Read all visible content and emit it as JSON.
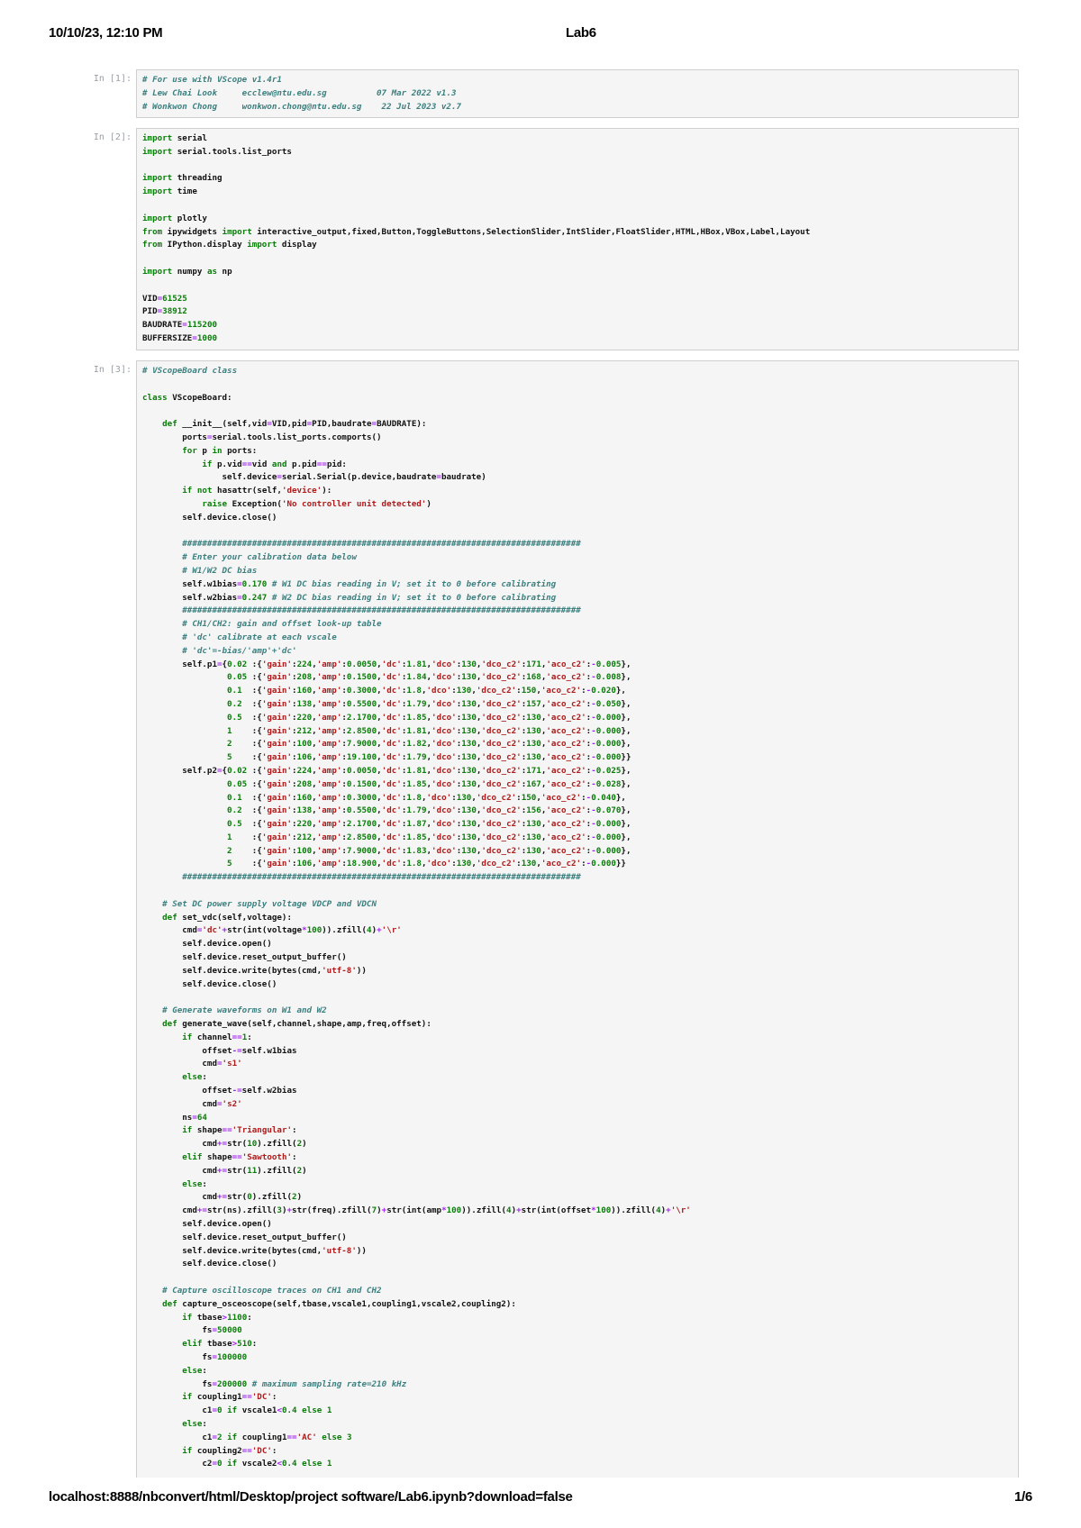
{
  "header": {
    "datetime": "10/10/23, 12:10 PM",
    "title": "Lab6"
  },
  "footer": {
    "url": "localhost:8888/nbconvert/html/Desktop/project software/Lab6.ipynb?download=false",
    "page": "1/6"
  },
  "cells": [
    {
      "prompt": "In [1]:",
      "lines": [
        "# For use with VScope v1.4r1",
        "# Lew Chai Look     ecclew@ntu.edu.sg          07 Mar 2022 v1.3",
        "# Wonkwon Chong     wonkwon.chong@ntu.edu.sg    22 Jul 2023 v2.7"
      ]
    },
    {
      "prompt": "In [2]:",
      "lines": [
        "import serial",
        "import serial.tools.list_ports",
        "",
        "import threading",
        "import time",
        "",
        "import plotly",
        "from ipywidgets import interactive_output,fixed,Button,ToggleButtons,SelectionSlider,IntSlider,FloatSlider,HTML,HBox,VBox,Label,Layout",
        "from IPython.display import display",
        "",
        "import numpy as np",
        "",
        "VID=61525",
        "PID=38912",
        "BAUDRATE=115200",
        "BUFFERSIZE=1000"
      ]
    },
    {
      "prompt": "In [3]:",
      "lines": [
        "# VScopeBoard class",
        "",
        "class VScopeBoard:",
        "",
        "    def __init__(self,vid=VID,pid=PID,baudrate=BAUDRATE):",
        "        ports=serial.tools.list_ports.comports()",
        "        for p in ports:",
        "            if p.vid==vid and p.pid==pid:",
        "                self.device=serial.Serial(p.device,baudrate=baudrate)",
        "        if not hasattr(self,'device'):",
        "            raise Exception('No controller unit detected')",
        "        self.device.close()",
        "",
        "        ################################################################################",
        "        # Enter your calibration data below",
        "        # W1/W2 DC bias",
        "        self.w1bias=0.170 # W1 DC bias reading in V; set it to 0 before calibrating",
        "        self.w2bias=0.247 # W2 DC bias reading in V; set it to 0 before calibrating",
        "        ################################################################################",
        "        # CH1/CH2: gain and offset look-up table",
        "        # 'dc' calibrate at each vscale",
        "        # 'dc'=-bias/'amp'+'dc'",
        "        self.p1={0.02 :{'gain':224,'amp':0.0050,'dc':1.81,'dco':130,'dco_c2':171,'aco_c2':-0.005},",
        "                 0.05 :{'gain':208,'amp':0.1500,'dc':1.84,'dco':130,'dco_c2':168,'aco_c2':-0.008},",
        "                 0.1  :{'gain':160,'amp':0.3000,'dc':1.8,'dco':130,'dco_c2':150,'aco_c2':-0.020},",
        "                 0.2  :{'gain':138,'amp':0.5500,'dc':1.79,'dco':130,'dco_c2':157,'aco_c2':-0.050},",
        "                 0.5  :{'gain':220,'amp':2.1700,'dc':1.85,'dco':130,'dco_c2':130,'aco_c2':-0.000},",
        "                 1    :{'gain':212,'amp':2.8500,'dc':1.81,'dco':130,'dco_c2':130,'aco_c2':-0.000},",
        "                 2    :{'gain':100,'amp':7.9000,'dc':1.82,'dco':130,'dco_c2':130,'aco_c2':-0.000},",
        "                 5    :{'gain':106,'amp':19.100,'dc':1.79,'dco':130,'dco_c2':130,'aco_c2':-0.000}}",
        "        self.p2={0.02 :{'gain':224,'amp':0.0050,'dc':1.81,'dco':130,'dco_c2':171,'aco_c2':-0.025},",
        "                 0.05 :{'gain':208,'amp':0.1500,'dc':1.85,'dco':130,'dco_c2':167,'aco_c2':-0.028},",
        "                 0.1  :{'gain':160,'amp':0.3000,'dc':1.8,'dco':130,'dco_c2':150,'aco_c2':-0.040},",
        "                 0.2  :{'gain':138,'amp':0.5500,'dc':1.79,'dco':130,'dco_c2':156,'aco_c2':-0.070},",
        "                 0.5  :{'gain':220,'amp':2.1700,'dc':1.87,'dco':130,'dco_c2':130,'aco_c2':-0.000},",
        "                 1    :{'gain':212,'amp':2.8500,'dc':1.85,'dco':130,'dco_c2':130,'aco_c2':-0.000},",
        "                 2    :{'gain':100,'amp':7.9000,'dc':1.83,'dco':130,'dco_c2':130,'aco_c2':-0.000},",
        "                 5    :{'gain':106,'amp':18.900,'dc':1.8,'dco':130,'dco_c2':130,'aco_c2':-0.000}}",
        "        ################################################################################",
        "",
        "    # Set DC power supply voltage VDCP and VDCN",
        "    def set_vdc(self,voltage):",
        "        cmd='dc'+str(int(voltage*100)).zfill(4)+'\\r'",
        "        self.device.open()",
        "        self.device.reset_output_buffer()",
        "        self.device.write(bytes(cmd,'utf-8'))",
        "        self.device.close()",
        "",
        "    # Generate waveforms on W1 and W2",
        "    def generate_wave(self,channel,shape,amp,freq,offset):",
        "        if channel==1:",
        "            offset-=self.w1bias",
        "            cmd='s1'",
        "        else:",
        "            offset-=self.w2bias",
        "            cmd='s2'",
        "        ns=64",
        "        if shape=='Triangular':",
        "            cmd+=str(10).zfill(2)",
        "        elif shape=='Sawtooth':",
        "            cmd+=str(11).zfill(2)",
        "        else:",
        "            cmd+=str(0).zfill(2)",
        "        cmd+=str(ns).zfill(3)+str(freq).zfill(7)+str(int(amp*100)).zfill(4)+str(int(offset*100)).zfill(4)+'\\r'",
        "        self.device.open()",
        "        self.device.reset_output_buffer()",
        "        self.device.write(bytes(cmd,'utf-8'))",
        "        self.device.close()",
        "",
        "    # Capture oscilloscope traces on CH1 and CH2",
        "    def capture_osceoscope(self,tbase,vscale1,coupling1,vscale2,coupling2):",
        "        if tbase>1100:",
        "            fs=50000",
        "        elif tbase>510:",
        "            fs=100000",
        "        else:",
        "            fs=200000 # maximum sampling rate=210 kHz",
        "        if coupling1=='DC':",
        "            c1=0 if vscale1<0.4 else 1",
        "        else:",
        "            c1=2 if coupling1=='AC' else 3",
        "        if coupling2=='DC':",
        "            c2=0 if vscale2<0.4 else 1"
      ]
    }
  ]
}
